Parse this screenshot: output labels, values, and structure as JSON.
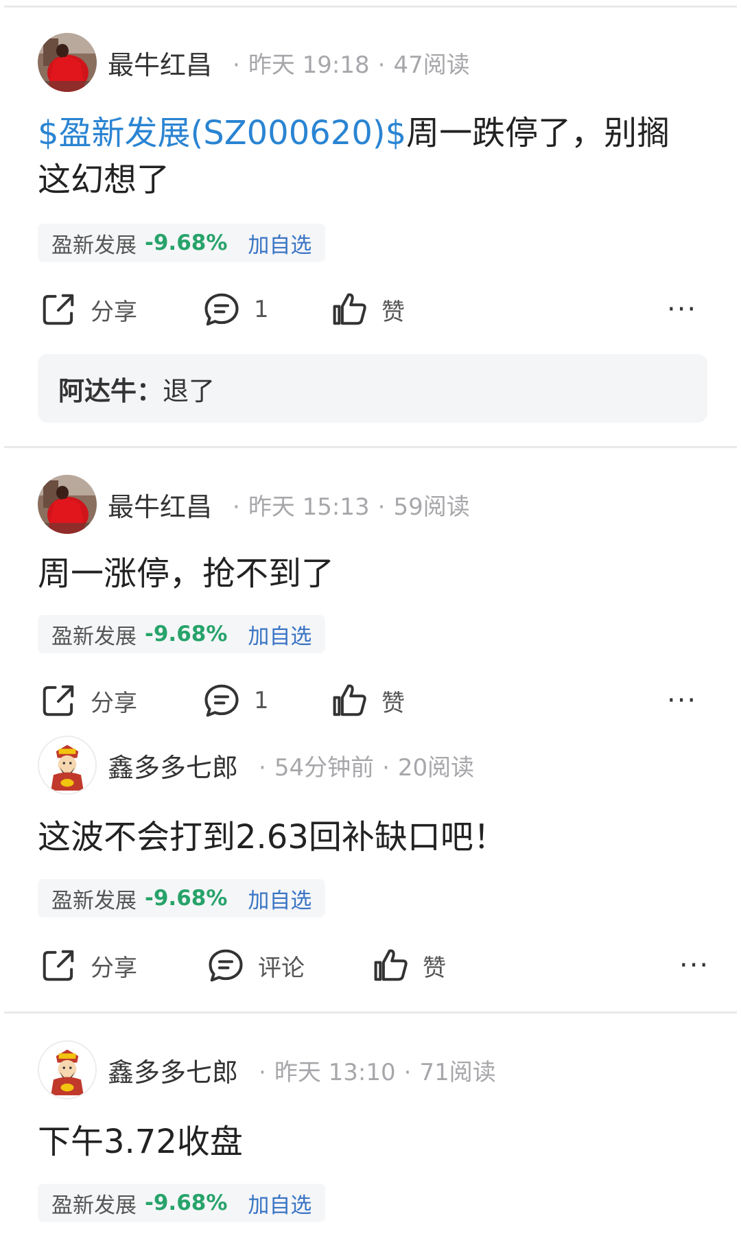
{
  "posts": [
    {
      "author": "最牛红昌",
      "time": "昨天 19:18",
      "reads": "47阅读",
      "content_link": "$盈新发展(SZ000620)$",
      "content": "周一跌停了，别搁这幻想了",
      "stock": {
        "name": "盈新发展",
        "change": "-9.68%",
        "add": "加自选"
      },
      "actions": {
        "share": "分享",
        "comment": "1",
        "like": "赞",
        "more": "···"
      },
      "reply": {
        "name": "阿达牛：",
        "text": "退了"
      }
    },
    {
      "author": "最牛红昌",
      "time": "昨天 15:13",
      "reads": "59阅读",
      "content": "周一涨停，抢不到了",
      "stock": {
        "name": "盈新发展",
        "change": "-9.68%",
        "add": "加自选"
      },
      "actions": {
        "share": "分享",
        "comment": "1",
        "like": "赞",
        "more": "···"
      }
    },
    {
      "author": "鑫多多七郎",
      "time": "54分钟前",
      "reads": "20阅读",
      "content": "这波不会打到2.63回补缺口吧！",
      "stock": {
        "name": "盈新发展",
        "change": "-9.68%",
        "add": "加自选"
      },
      "actions": {
        "share": "分享",
        "comment": "评论",
        "like": "赞",
        "more": "···"
      }
    },
    {
      "author": "鑫多多七郎",
      "time": "昨天 13:10",
      "reads": "71阅读",
      "content": "下午3.72收盘",
      "stock": {
        "name": "盈新发展",
        "change": "-9.68%",
        "add": "加自选"
      }
    }
  ],
  "meta_separator": "·",
  "colors": {
    "link": "#2a84d2",
    "down": "#27a36a",
    "add": "#3a74c4",
    "meta": "#a7a7ab"
  }
}
